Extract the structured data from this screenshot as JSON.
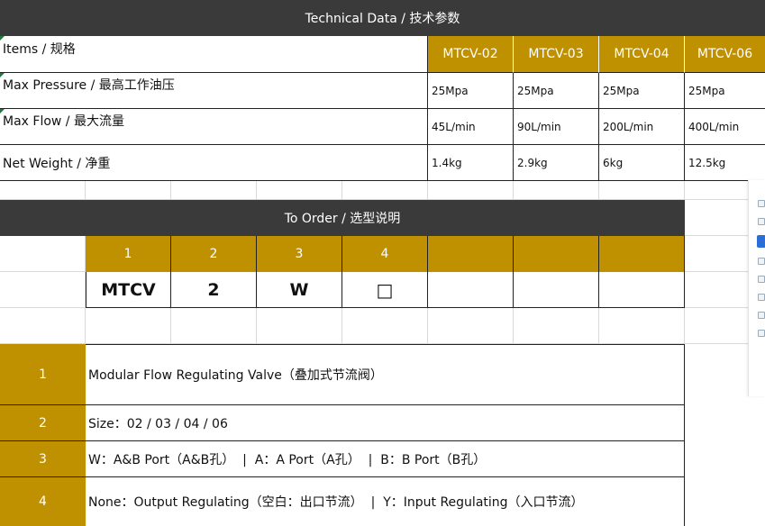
{
  "technical": {
    "title": "Technical Data / 技术参数",
    "items_label": "Items / 规格",
    "models": [
      "MTCV-02",
      "MTCV-03",
      "MTCV-04",
      "MTCV-06"
    ],
    "rows": [
      {
        "label": "Max Pressure / 最高工作油压",
        "values": [
          "25Mpa",
          "25Mpa",
          "25Mpa",
          "25Mpa"
        ]
      },
      {
        "label": "Max Flow / 最大流量",
        "values": [
          "45L/min",
          "90L/min",
          "200L/min",
          "400L/min"
        ]
      },
      {
        "label": "Net Weight / 净重",
        "values": [
          "1.4kg",
          "2.9kg",
          "6kg",
          "12.5kg"
        ]
      }
    ]
  },
  "order": {
    "title": "To Order / 选型说明",
    "positions": [
      "1",
      "2",
      "3",
      "4"
    ],
    "codes": [
      "MTCV",
      "2",
      "W",
      "□"
    ]
  },
  "legend": [
    {
      "num": "1",
      "text": "Modular Flow Regulating Valve（叠加式节流阀）"
    },
    {
      "num": "2",
      "text": "Size：02 / 03 / 04 / 06"
    },
    {
      "num": "3",
      "text": "W：A&B Port（A&B孔）  |  A：A Port（A孔）  |  B：B Port（B孔）"
    },
    {
      "num": "4",
      "text": "None：Output Regulating（空白：出口节流）  |  Y：Input Regulating（入口节流）"
    }
  ]
}
